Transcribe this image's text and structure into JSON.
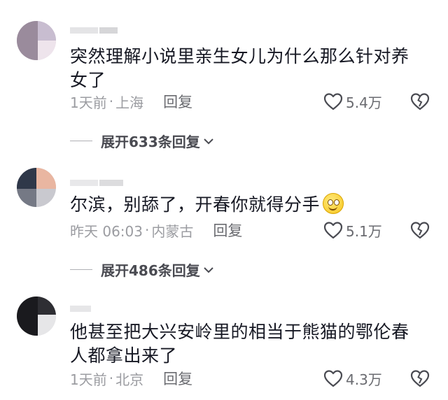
{
  "comments": [
    {
      "text": "突然理解小说里亲生女儿为什么那么针对养女了",
      "time": "1天前",
      "location": "上海",
      "reply_label": "回复",
      "likes": "5.4万",
      "expand_label": "展开633条回复",
      "avatar_colors": [
        "#8e7f8f",
        "#c9bcc8",
        "#e7d9e2",
        "#5d5468"
      ]
    },
    {
      "text": "尔滨，别舔了，开春你就得分手",
      "emoji": "smiling-face-emoji",
      "time": "昨天 06:03",
      "location": "内蒙古",
      "reply_label": "回复",
      "likes": "5.1万",
      "expand_label": "展开486条回复",
      "avatar_colors": [
        "#3a4356",
        "#e7b7a3",
        "#c9c9cf",
        "#7c7f8a"
      ]
    },
    {
      "text": "他甚至把大兴安岭里的相当于熊猫的鄂伦春人都拿出来了",
      "time": "1天前",
      "location": "北京",
      "reply_label": "回复",
      "likes": "4.3万",
      "avatar_colors": [
        "#1b1b1f",
        "#2c2c30",
        "#c4c4c6",
        "#e2e2e4"
      ]
    }
  ],
  "separator": "·",
  "icons": {
    "like": "heart-outline-icon",
    "dislike": "broken-heart-icon",
    "chevron": "chevron-down-icon"
  },
  "colors": {
    "text": "#161823",
    "meta": "#9b9ca1",
    "reply": "#6a6b70"
  }
}
